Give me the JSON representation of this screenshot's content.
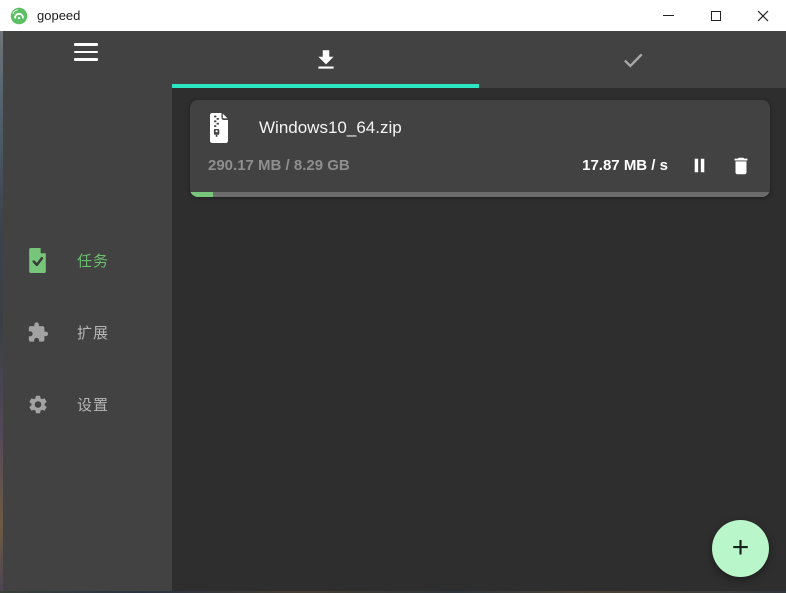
{
  "window": {
    "title": "gopeed",
    "controls": {
      "minimize_icon": "minimize-dash",
      "maximize_icon": "maximize-square",
      "close_icon": "close-x"
    }
  },
  "sidebar": {
    "items": [
      {
        "label": "任务",
        "icon": "task-document-check-icon",
        "active": true
      },
      {
        "label": "扩展",
        "icon": "puzzle-piece-icon",
        "active": false
      },
      {
        "label": "设置",
        "icon": "gear-icon",
        "active": false
      }
    ]
  },
  "tabs": [
    {
      "name": "downloading",
      "icon": "download-icon",
      "active": true
    },
    {
      "name": "completed",
      "icon": "check-icon",
      "active": false
    }
  ],
  "task": {
    "icon": "zip-file-icon",
    "filename": "Windows10_64.zip",
    "size_progress": "290.17 MB / 8.29 GB",
    "speed": "17.87 MB / s",
    "progress_percent": 4
  },
  "fab": {
    "label": "+"
  },
  "colors": {
    "accent_green": "#6abf6e",
    "tab_indicator": "#2ee6c3",
    "fab_bg": "#b9f6ca",
    "progress_fill": "#76c57a",
    "sidebar_bg": "#424242",
    "content_bg": "#2e2e2e"
  }
}
